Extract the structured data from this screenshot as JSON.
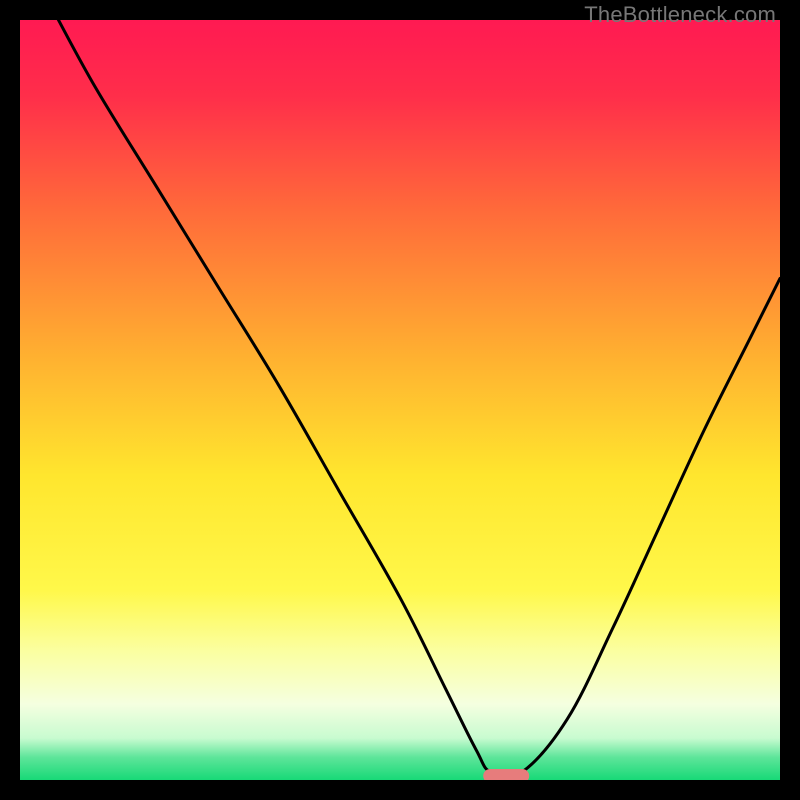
{
  "watermark": "TheBottleneck.com",
  "gradient_stops": [
    {
      "offset": 0.0,
      "color": "#ff1a52"
    },
    {
      "offset": 0.1,
      "color": "#ff2e4a"
    },
    {
      "offset": 0.25,
      "color": "#ff6a3a"
    },
    {
      "offset": 0.45,
      "color": "#ffb330"
    },
    {
      "offset": 0.6,
      "color": "#ffe62e"
    },
    {
      "offset": 0.75,
      "color": "#fff84a"
    },
    {
      "offset": 0.83,
      "color": "#fbffa0"
    },
    {
      "offset": 0.9,
      "color": "#f5ffe0"
    },
    {
      "offset": 0.945,
      "color": "#c8fbd0"
    },
    {
      "offset": 0.97,
      "color": "#5ee59a"
    },
    {
      "offset": 1.0,
      "color": "#17d977"
    }
  ],
  "chart_data": {
    "type": "line",
    "title": "",
    "xlabel": "",
    "ylabel": "",
    "xlim": [
      0,
      100
    ],
    "ylim": [
      0,
      100
    ],
    "grid": false,
    "legend": "none",
    "series": [
      {
        "name": "bottleneck-curve",
        "x": [
          4,
          10,
          18,
          26,
          34,
          42,
          50,
          56,
          60,
          62,
          66,
          72,
          78,
          84,
          90,
          96,
          100
        ],
        "y": [
          102,
          91,
          78,
          65,
          52,
          38,
          24,
          12,
          4,
          1,
          1,
          8,
          20,
          33,
          46,
          58,
          66
        ]
      }
    ],
    "annotations": [
      {
        "type": "marker",
        "shape": "pill",
        "x": 64,
        "y": 0.5,
        "width_pct": 6,
        "color": "#e77c7c"
      }
    ]
  }
}
